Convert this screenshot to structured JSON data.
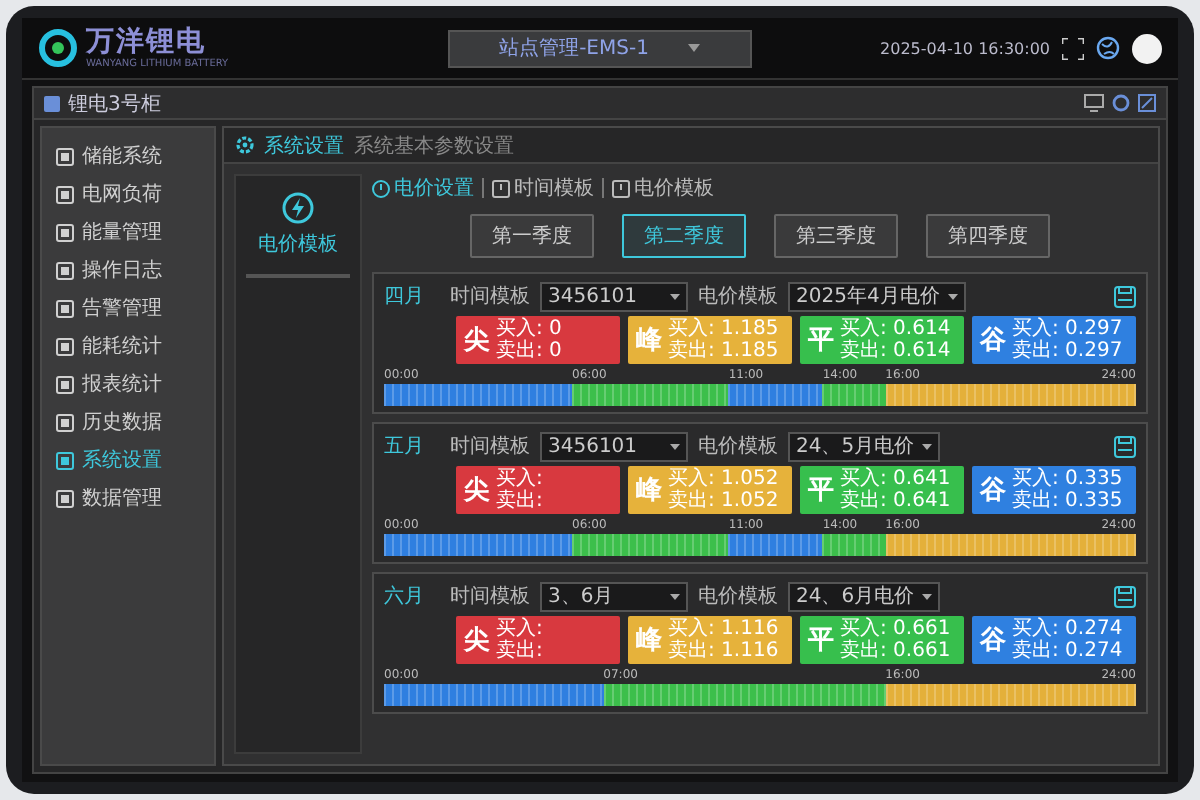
{
  "header": {
    "logo_text": "万洋锂电",
    "logo_subtitle": "WANYANG LITHIUM BATTERY",
    "site_select": "站点管理-EMS-1",
    "datetime": "2025-04-10 16:30:00"
  },
  "panel": {
    "title": "锂电3号柜"
  },
  "sidebar": {
    "items": [
      {
        "label": "储能系统",
        "selected": false
      },
      {
        "label": "电网负荷",
        "selected": false
      },
      {
        "label": "能量管理",
        "selected": false
      },
      {
        "label": "操作日志",
        "selected": false
      },
      {
        "label": "告警管理",
        "selected": false
      },
      {
        "label": "能耗统计",
        "selected": false
      },
      {
        "label": "报表统计",
        "selected": false
      },
      {
        "label": "历史数据",
        "selected": false
      },
      {
        "label": "系统设置",
        "selected": true
      },
      {
        "label": "数据管理",
        "selected": false
      }
    ]
  },
  "breadcrumb": {
    "title": "系统设置",
    "subtitle": "系统基本参数设置"
  },
  "template_card": {
    "label": "电价模板"
  },
  "tabs": [
    {
      "label": "电价设置",
      "selected": true
    },
    {
      "label": "时间模板",
      "selected": false
    },
    {
      "label": "电价模板",
      "selected": false
    }
  ],
  "seasons": [
    {
      "label": "第一季度",
      "selected": false
    },
    {
      "label": "第二季度",
      "selected": true
    },
    {
      "label": "第三季度",
      "selected": false
    },
    {
      "label": "第四季度",
      "selected": false
    }
  ],
  "months": [
    {
      "month": "四月",
      "time_label": "时间模板",
      "time_value": "3456101",
      "price_label": "电价模板",
      "price_value": "2025年4月电价",
      "prices": [
        {
          "kind": "sharp",
          "symbol": "尖",
          "buy": "买入: 0",
          "sell": "卖出: 0"
        },
        {
          "kind": "peak",
          "symbol": "峰",
          "buy": "买入: 1.185",
          "sell": "卖出: 1.185"
        },
        {
          "kind": "flat",
          "symbol": "平",
          "buy": "买入: 0.614",
          "sell": "卖出: 0.614"
        },
        {
          "kind": "valley",
          "symbol": "谷",
          "buy": "买入: 0.297",
          "sell": "卖出: 0.297"
        }
      ],
      "ticks": [
        "00:00",
        "06:00",
        "11:00",
        "14:00",
        "16:00",
        "24:00"
      ],
      "segments": [
        {
          "kind": "valley"
        },
        {
          "kind": "flat"
        },
        {
          "kind": "valley"
        },
        {
          "kind": "flat"
        },
        {
          "kind": "peak"
        }
      ]
    },
    {
      "month": "五月",
      "time_label": "时间模板",
      "time_value": "3456101",
      "price_label": "电价模板",
      "price_value": "24、5月电价",
      "prices": [
        {
          "kind": "sharp",
          "symbol": "尖",
          "buy": "买入:",
          "sell": "卖出:"
        },
        {
          "kind": "peak",
          "symbol": "峰",
          "buy": "买入: 1.052",
          "sell": "卖出: 1.052"
        },
        {
          "kind": "flat",
          "symbol": "平",
          "buy": "买入: 0.641",
          "sell": "卖出: 0.641"
        },
        {
          "kind": "valley",
          "symbol": "谷",
          "buy": "买入: 0.335",
          "sell": "卖出: 0.335"
        }
      ],
      "ticks": [
        "00:00",
        "06:00",
        "11:00",
        "14:00",
        "16:00",
        "24:00"
      ],
      "segments": [
        {
          "kind": "valley"
        },
        {
          "kind": "flat"
        },
        {
          "kind": "valley"
        },
        {
          "kind": "flat"
        },
        {
          "kind": "peak"
        }
      ]
    },
    {
      "month": "六月",
      "time_label": "时间模板",
      "time_value": "3、6月",
      "price_label": "电价模板",
      "price_value": "24、6月电价",
      "prices": [
        {
          "kind": "sharp",
          "symbol": "尖",
          "buy": "买入:",
          "sell": "卖出:"
        },
        {
          "kind": "peak",
          "symbol": "峰",
          "buy": "买入: 1.116",
          "sell": "卖出: 1.116"
        },
        {
          "kind": "flat",
          "symbol": "平",
          "buy": "买入: 0.661",
          "sell": "卖出: 0.661"
        },
        {
          "kind": "valley",
          "symbol": "谷",
          "buy": "买入: 0.274",
          "sell": "卖出: 0.274"
        }
      ],
      "ticks": [
        "00:00",
        "07:00",
        "16:00",
        "24:00"
      ],
      "segments": [
        {
          "kind": "valley"
        },
        {
          "kind": "flat"
        },
        {
          "kind": "peak"
        }
      ]
    }
  ]
}
